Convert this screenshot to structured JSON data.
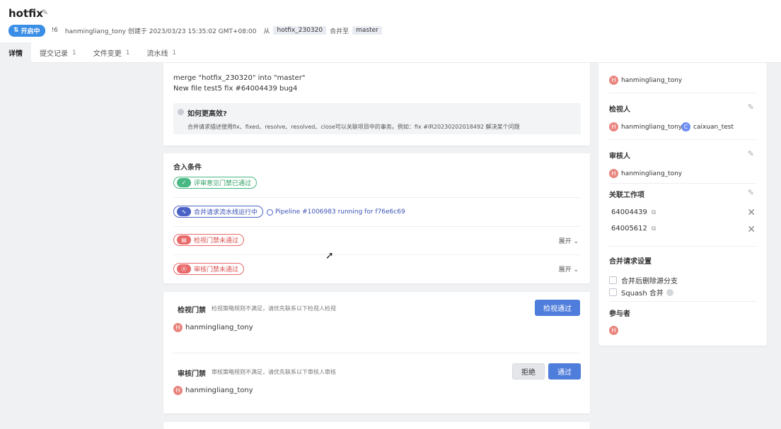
{
  "header": {
    "title": "hotfix",
    "status": "开启中",
    "mr_id": "!6",
    "creator_text": "hanmingliang_tony 创建于 2023/03/23 15:35:02 GMT+08:00",
    "from_label": "从",
    "source_branch": "hotfix_230320",
    "merge_to_label": "合并至",
    "target_branch": "master"
  },
  "tabs": [
    {
      "label": "详情",
      "count": ""
    },
    {
      "label": "提交记录",
      "count": "1"
    },
    {
      "label": "文件变更",
      "count": "1"
    },
    {
      "label": "流水线",
      "count": "1"
    }
  ],
  "description": {
    "line1": "merge \"hotfix_230320\" into \"master\"",
    "line2": "New file test5 fix #64004439 bug4",
    "hint_title": "如何更高效?",
    "hint_body": "合并请求描述使用fix、fixed、resolve、resolved、close可以关联项目中的事务。例如：fix #IR20230202018492 解决某个问题"
  },
  "conditions": {
    "title": "合入条件",
    "items": [
      {
        "label": "评审意见门禁已通过",
        "color": "#47b881"
      },
      {
        "label": "合并请求流水线运行中",
        "color": "#4a62c6"
      },
      {
        "label": "检视门禁未通过",
        "color": "#e86a6a"
      },
      {
        "label": "审核门禁未通过",
        "color": "#e86a6a"
      }
    ],
    "pipeline_text": "Pipeline #1006983 running for f76e6c69",
    "expand_label": "展开"
  },
  "review_gate": {
    "title": "检视门禁",
    "desc": "检视策略规则不满足，请优先联系以下检视人检视",
    "user": "hanmingliang_tony",
    "button": "检视通过"
  },
  "approve_gate": {
    "title": "审核门禁",
    "desc": "审核策略规则不满足，请优先联系以下审核人审核",
    "user": "hanmingliang_tony",
    "reject_button": "拒绝",
    "approve_button": "通过"
  },
  "sidebar": {
    "merger_user": "hanmingliang_tony",
    "reviewers_title": "检视人",
    "reviewers": [
      "hanmingliang_tony",
      "caixuan_test"
    ],
    "approvers_title": "审核人",
    "approvers": [
      "hanmingliang_tony"
    ],
    "work_items_title": "关联工作项",
    "work_items": [
      "64004439",
      "64005612"
    ],
    "settings_title": "合并请求设置",
    "setting_delete_branch": "合并后删除源分支",
    "setting_squash": "Squash 合并",
    "participants_title": "参与者"
  },
  "colors": {
    "primary": "#4f7ddb",
    "status": "#3a8ee6",
    "avatar": "#e9857e"
  }
}
